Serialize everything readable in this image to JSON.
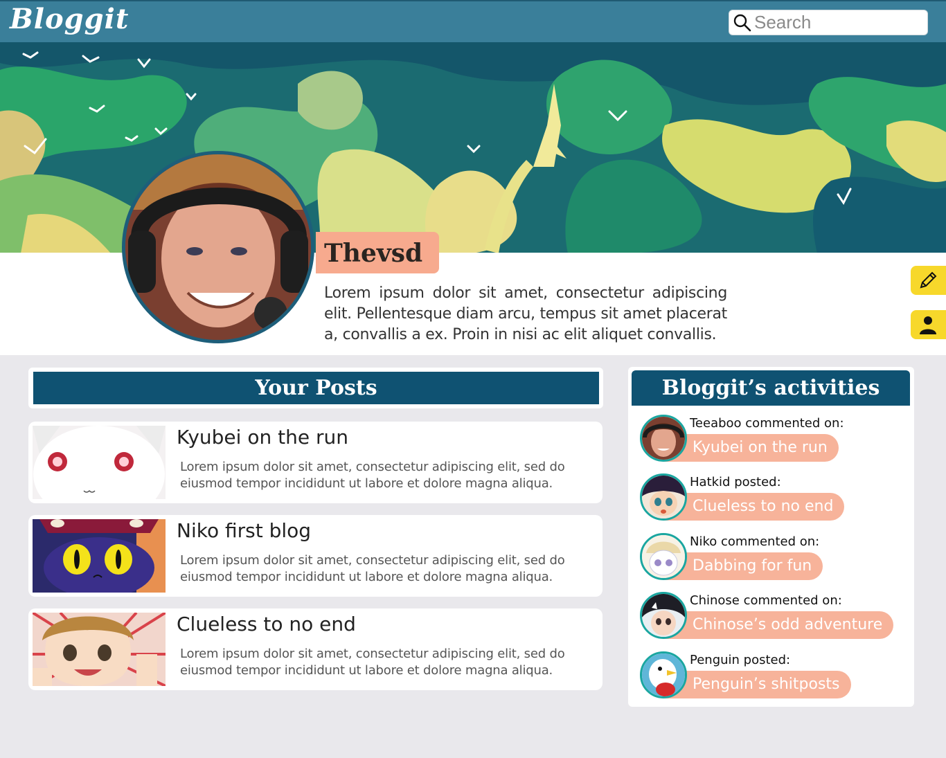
{
  "app": {
    "logo": "Bloggit"
  },
  "search": {
    "placeholder": "Search"
  },
  "profile": {
    "username": "Thevsd",
    "bio": "Lorem ipsum dolor sit amet, consectetur adipiscing elit. Pellentesque diam arcu, tempus sit amet placerat a, convallis a ex. Proin in nisi ac elit aliquet convallis."
  },
  "side_actions": [
    {
      "icon": "pencil-icon"
    },
    {
      "icon": "user-icon"
    }
  ],
  "posts": {
    "header": "Your Posts",
    "items": [
      {
        "title": "Kyubei on the run",
        "excerpt": "Lorem ipsum dolor sit amet, consectetur adipiscing elit, sed do eiusmod tempor incididunt ut labore et dolore magna aliqua."
      },
      {
        "title": "Niko first blog",
        "excerpt": "Lorem ipsum dolor sit amet, consectetur adipiscing elit, sed do eiusmod tempor incididunt ut labore et dolore magna aliqua."
      },
      {
        "title": "Clueless to no end",
        "excerpt": "Lorem ipsum dolor sit amet, consectetur adipiscing elit, sed do eiusmod tempor incididunt ut labore et dolore magna aliqua."
      }
    ]
  },
  "activities": {
    "header": "Bloggit’s activities",
    "items": [
      {
        "text": "Teeaboo commented on:",
        "post": "Kyubei on the run"
      },
      {
        "text": "Hatkid posted:",
        "post": "Clueless to no end"
      },
      {
        "text": "Niko commented on:",
        "post": "Dabbing for fun"
      },
      {
        "text": "Chinose commented on:",
        "post": "Chinose’s odd adventure"
      },
      {
        "text": "Penguin posted:",
        "post": "Penguin’s shitposts"
      }
    ]
  },
  "colors": {
    "topbar": "#3a7f9a",
    "header_blue": "#0f5272",
    "accent_salmon": "#f7aa8e",
    "accent_yellow": "#f7d82b"
  }
}
